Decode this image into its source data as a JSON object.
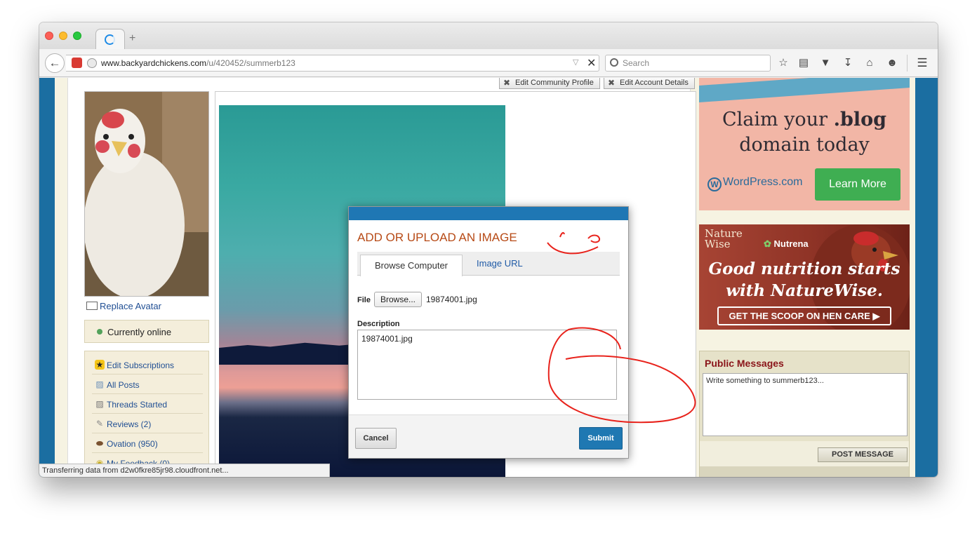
{
  "browser": {
    "url_domain": "www.backyardchickens.com",
    "url_path": "/u/420452/summerb123",
    "search_placeholder": "Search",
    "status_text": "Transferring data from d2w0fkre85jr98.cloudfront.net..."
  },
  "profile_actions": {
    "edit_community_profile": "Edit Community Profile",
    "edit_account_details": "Edit Account Details"
  },
  "left_sidebar": {
    "replace_avatar": "Replace Avatar",
    "online_status": "Currently online",
    "menu": [
      {
        "label": "Edit Subscriptions",
        "icon": "star-icon"
      },
      {
        "label": "All Posts",
        "icon": "chat-bubbles-icon"
      },
      {
        "label": "Threads Started",
        "icon": "chat-bubbles-icon"
      },
      {
        "label": "Reviews (2)",
        "icon": "pencil-icon"
      },
      {
        "label": "Ovation (950)",
        "icon": "egg-icon"
      },
      {
        "label": "My Feedback (0)",
        "icon": "feedback-icon"
      }
    ]
  },
  "modal": {
    "title": "ADD OR UPLOAD AN IMAGE",
    "tabs": [
      "Browse Computer",
      "Image URL"
    ],
    "file_label": "File",
    "browse_label": "Browse...",
    "file_name": "19874001.jpg",
    "description_label": "Description",
    "description_value": "19874001.jpg",
    "cancel_label": "Cancel",
    "submit_label": "Submit"
  },
  "ads": {
    "wordpress": {
      "headline_line1": "Claim your ",
      "headline_bold": ".blog",
      "headline_line2": "domain today",
      "brand": "WordPress.com",
      "cta": "Learn More"
    },
    "naturewise": {
      "brand1_line1": "Nature",
      "brand1_line2": "Wise",
      "brand2": "Nutrena",
      "slogan_line1": "Good nutrition starts",
      "slogan_line2": "with NatureWise.",
      "cta": "GET THE SCOOP ON HEN CARE"
    }
  },
  "public_messages": {
    "title": "Public Messages",
    "placeholder": "Write something to summerb123...",
    "post_button": "POST MESSAGE"
  },
  "colors": {
    "page_blue": "#1b6ea1",
    "modal_accent": "#1f77b4",
    "title_orange": "#b74a16",
    "annotation_red": "#e8231c"
  }
}
